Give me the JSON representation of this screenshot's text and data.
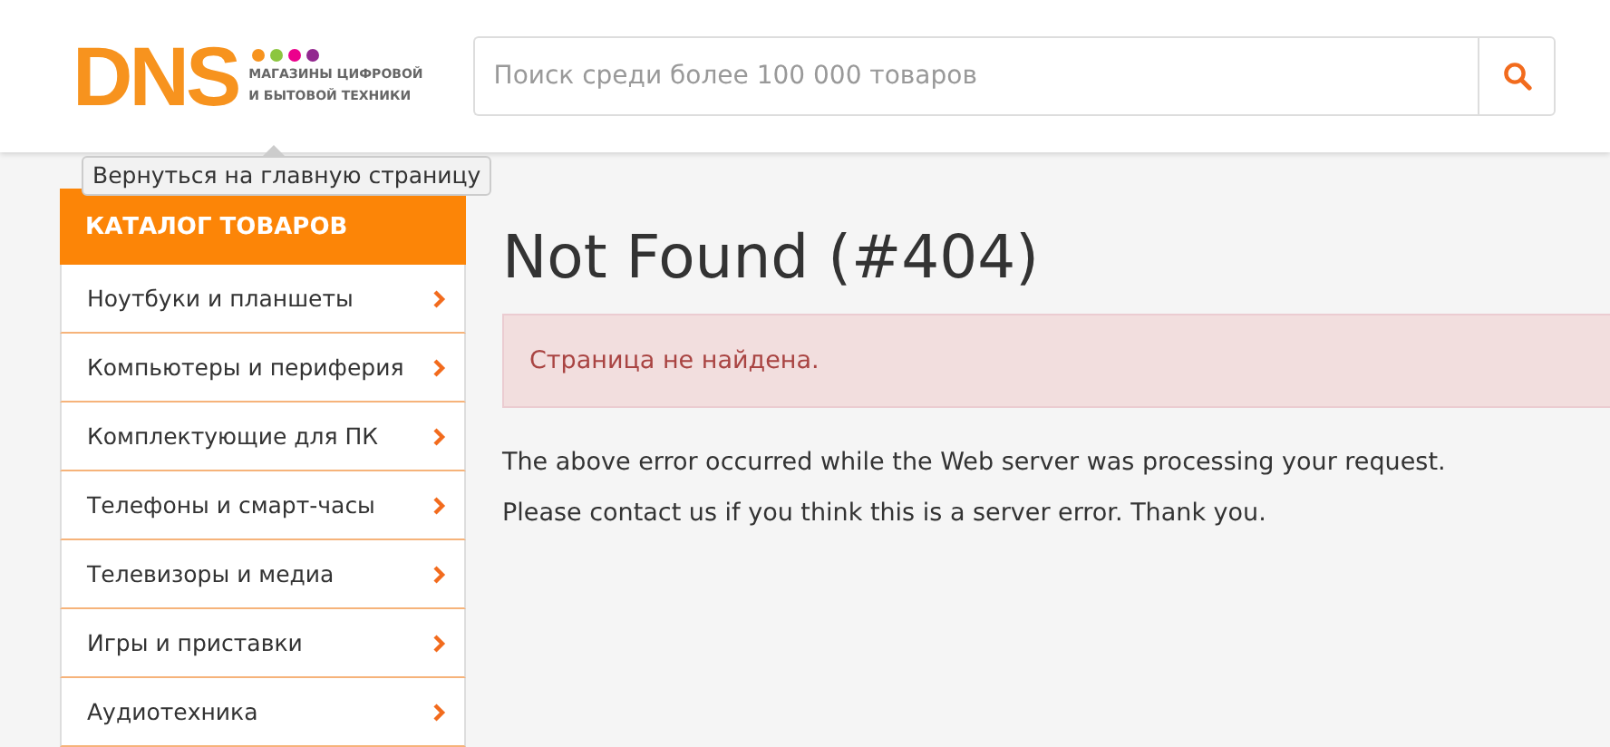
{
  "logo": {
    "wordmark": "DNS",
    "tagline": [
      "МАГАЗИНЫ ЦИФРОВОЙ",
      "И БЫТОВОЙ ТЕХНИКИ"
    ],
    "dots": [
      {
        "color": "#f7931e"
      },
      {
        "color": "#8cc63f"
      },
      {
        "color": "#ec008c"
      },
      {
        "color": "#92278f"
      }
    ]
  },
  "tooltip": "Вернуться на главную страницу",
  "search": {
    "placeholder": "Поиск среди более 100 000 товаров"
  },
  "catalog": {
    "title": "КАТАЛОГ ТОВАРОВ",
    "items": [
      {
        "label": "Ноутбуки и планшеты"
      },
      {
        "label": "Компьютеры и периферия"
      },
      {
        "label": "Комплектующие для ПК"
      },
      {
        "label": "Телефоны и смарт-часы"
      },
      {
        "label": "Телевизоры и медиа"
      },
      {
        "label": "Игры и приставки"
      },
      {
        "label": "Аудиотехника"
      }
    ]
  },
  "main": {
    "title": "Not Found (#404)",
    "alert": "Страница не найдена.",
    "paragraphs": [
      "The above error occurred while the Web server was processing your request.",
      "Please contact us if you think this is a server error. Thank you."
    ]
  }
}
